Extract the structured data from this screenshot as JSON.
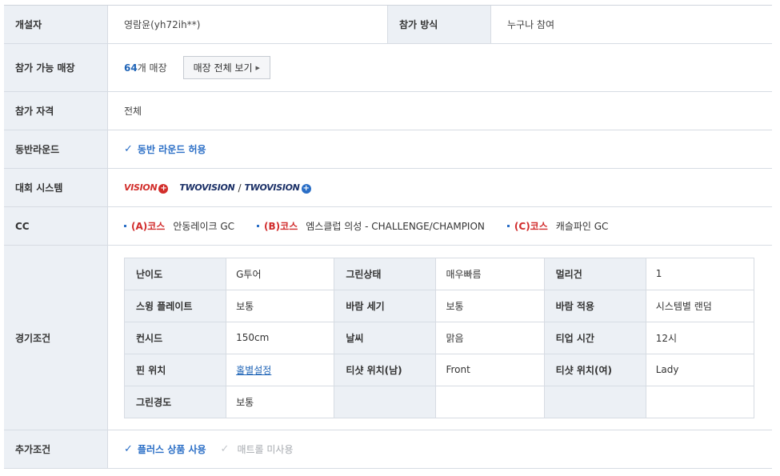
{
  "organizer": {
    "label": "개설자",
    "value": "영람윤(yh72ih**)"
  },
  "join_method": {
    "label": "참가 방식",
    "value": "누구나 참여"
  },
  "stores": {
    "label": "참가 가능 매장",
    "count": "64",
    "count_suffix": "개 매장",
    "button_label": "매장 전체 보기"
  },
  "eligibility": {
    "label": "참가 자격",
    "value": "전체"
  },
  "companion": {
    "label": "동반라운드",
    "value": "동반 라운드 허용"
  },
  "system": {
    "label": "대회 시스템",
    "logos": [
      "VISION",
      "TWOVISION",
      "TWOVISION"
    ],
    "separator": "/"
  },
  "cc": {
    "label": "CC",
    "items": [
      {
        "label": "(A)코스",
        "name": "안동레이크 GC"
      },
      {
        "label": "(B)코스",
        "name": "엠스클럽 의성 - CHALLENGE/CHAMPION"
      },
      {
        "label": "(C)코스",
        "name": "캐슬파인 GC"
      }
    ]
  },
  "conditions": {
    "label": "경기조건",
    "rows": [
      [
        {
          "h": "난이도",
          "v": "G투어"
        },
        {
          "h": "그린상태",
          "v": "매우빠름"
        },
        {
          "h": "멀리건",
          "v": "1"
        }
      ],
      [
        {
          "h": "스윙 플레이트",
          "v": "보통"
        },
        {
          "h": "바람 세기",
          "v": "보통"
        },
        {
          "h": "바람 적용",
          "v": "시스템별 랜덤"
        }
      ],
      [
        {
          "h": "컨시드",
          "v": "150cm"
        },
        {
          "h": "날씨",
          "v": "맑음"
        },
        {
          "h": "티업 시간",
          "v": "12시"
        }
      ],
      [
        {
          "h": "핀 위치",
          "v": "홀별설정"
        },
        {
          "h": "티샷 위치(남)",
          "v": "Front"
        },
        {
          "h": "티샷 위치(여)",
          "v": "Lady"
        }
      ],
      [
        {
          "h": "그린경도",
          "v": "보통"
        },
        {
          "h": "",
          "v": ""
        },
        {
          "h": "",
          "v": ""
        }
      ]
    ]
  },
  "extra": {
    "label": "추가조건",
    "option_on": "플러스 상품 사용",
    "option_off": "매트롤 미사용"
  },
  "colors": {
    "accent_blue": "#2a6ec6",
    "brand_red": "#d22e2b",
    "header_bg": "#ecf0f5"
  }
}
